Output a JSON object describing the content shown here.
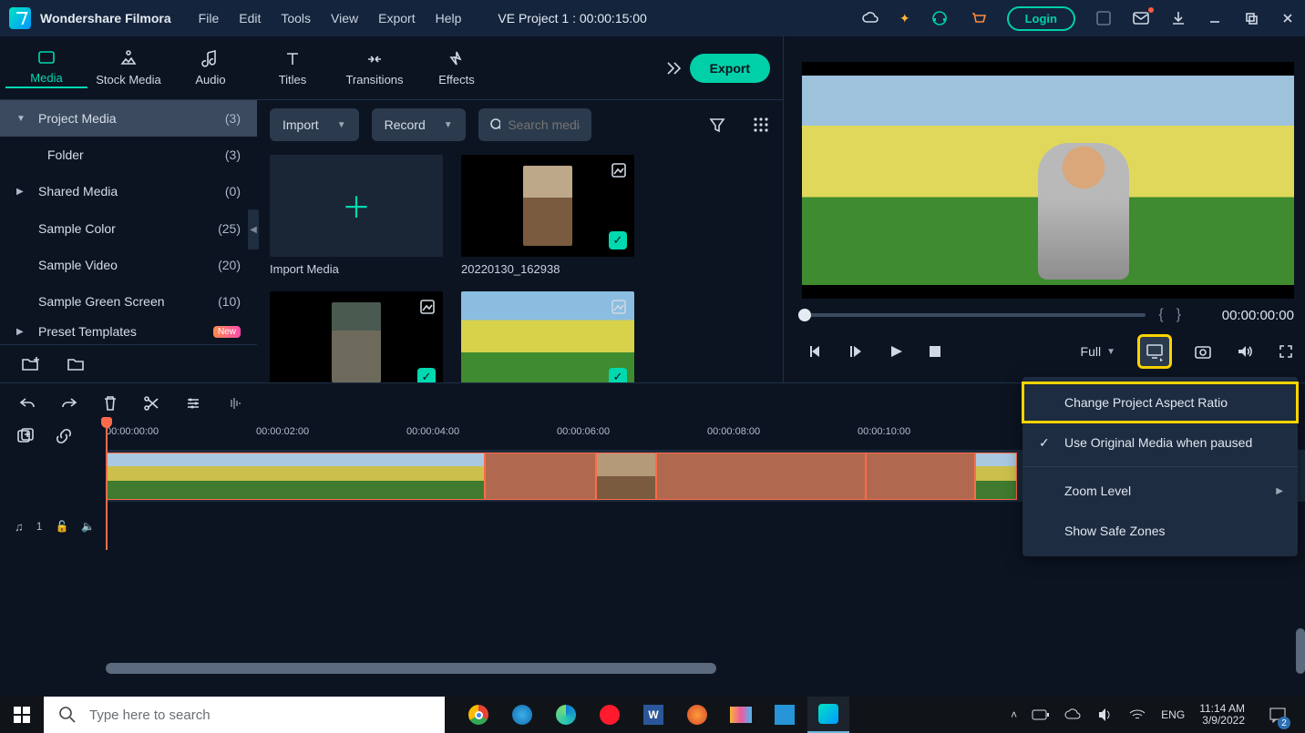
{
  "app_name": "Wondershare Filmora",
  "menus": [
    "File",
    "Edit",
    "Tools",
    "View",
    "Export",
    "Help"
  ],
  "project_label": "VE Project 1 : 00:00:15:00",
  "login_label": "Login",
  "module_tabs": [
    {
      "id": "media",
      "label": "Media"
    },
    {
      "id": "stock",
      "label": "Stock Media"
    },
    {
      "id": "audio",
      "label": "Audio"
    },
    {
      "id": "titles",
      "label": "Titles"
    },
    {
      "id": "transitions",
      "label": "Transitions"
    },
    {
      "id": "effects",
      "label": "Effects"
    }
  ],
  "export_button": "Export",
  "sidebar": [
    {
      "label": "Project Media",
      "count": "(3)",
      "arrow": "▼",
      "active": true
    },
    {
      "label": "Folder",
      "count": "(3)",
      "indent": true
    },
    {
      "label": "Shared Media",
      "count": "(0)",
      "arrow": "▶"
    },
    {
      "label": "Sample Color",
      "count": "(25)"
    },
    {
      "label": "Sample Video",
      "count": "(20)"
    },
    {
      "label": "Sample Green Screen",
      "count": "(10)"
    },
    {
      "label": "Preset Templates",
      "new": "New",
      "arrow": "▶",
      "cut": true
    }
  ],
  "import_dropdown": "Import",
  "record_dropdown": "Record",
  "search_placeholder": "Search media",
  "media_items": [
    {
      "type": "import",
      "label": "Import Media"
    },
    {
      "type": "clip",
      "label": "20220130_162938",
      "checked": true,
      "thumb": "photo1"
    },
    {
      "type": "clip",
      "label": "",
      "checked": true,
      "thumb": "photo2"
    },
    {
      "type": "clip",
      "label": "",
      "checked": true,
      "thumb": "photo3"
    }
  ],
  "preview": {
    "timecode": "00:00:00:00",
    "quality": "Full"
  },
  "context_menu": [
    {
      "label": "Change Project Aspect Ratio",
      "highlight": true
    },
    {
      "label": "Use Original Media when paused",
      "check": true
    },
    {
      "sep": true
    },
    {
      "label": "Zoom Level",
      "submenu": true
    },
    {
      "label": "Show Safe Zones"
    }
  ],
  "timeline": {
    "ruler": [
      "00:00:00:00",
      "00:00:02:00",
      "00:00:04:00",
      "00:00:06:00",
      "00:00:08:00",
      "00:00:10:00"
    ],
    "audio_track_label": "1"
  },
  "taskbar": {
    "search_placeholder": "Type here to search",
    "lang": "ENG",
    "time": "11:14 AM",
    "date": "3/9/2022",
    "notify_count": "2"
  }
}
